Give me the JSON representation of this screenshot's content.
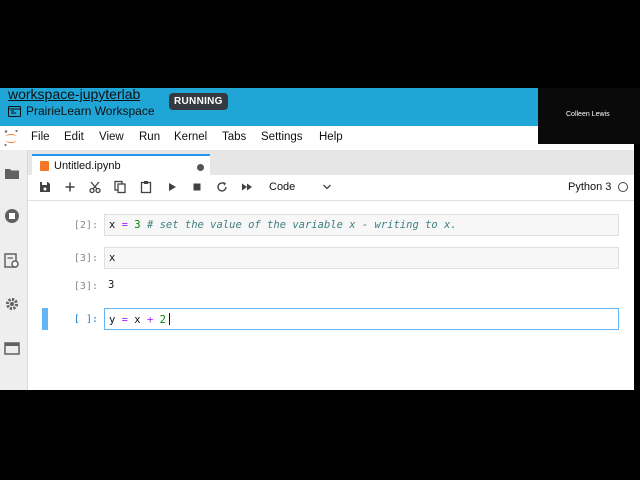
{
  "header": {
    "workspace_title": "workspace-jupyterlab",
    "subtitle": "PrairieLearn Workspace",
    "status_badge": "RUNNING"
  },
  "video_overlay": {
    "name": "Colleen Lewis"
  },
  "menubar": {
    "items": [
      "File",
      "Edit",
      "View",
      "Run",
      "Kernel",
      "Tabs",
      "Settings",
      "Help"
    ]
  },
  "tab": {
    "label": "Untitled.ipynb"
  },
  "toolbar": {
    "cell_type": "Code",
    "kernel": "Python 3"
  },
  "cells": [
    {
      "prompt": "[2]:",
      "code_parts": [
        "x",
        " = ",
        "3",
        " # set the value of the variable x - writing to x."
      ]
    },
    {
      "prompt": "[3]:",
      "code": "x",
      "output_prompt": "[3]:",
      "output": "3"
    },
    {
      "prompt": "[ ]:",
      "code_parts": [
        "y",
        " = ",
        "x",
        " + ",
        "2"
      ]
    }
  ],
  "colors": {
    "header_bg": "#1fa5d6",
    "active_cell": "#64b5f6",
    "accent": "#f37726"
  }
}
